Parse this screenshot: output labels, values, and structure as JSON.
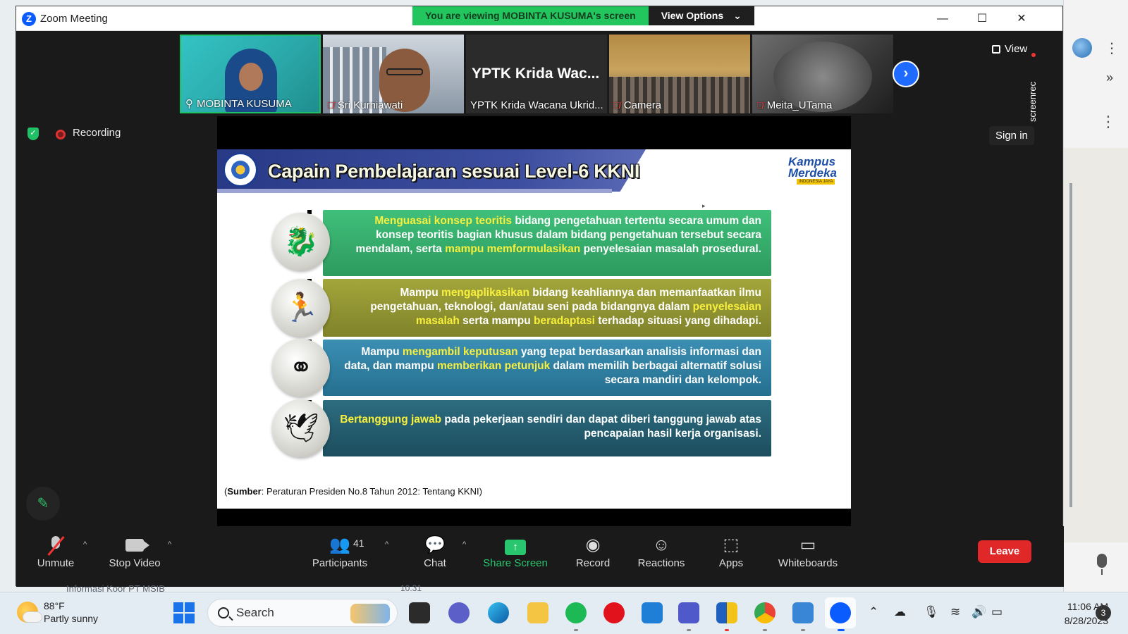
{
  "window": {
    "title": "Zoom Meeting"
  },
  "banner": {
    "viewing_text": "You are viewing MOBINTA KUSUMA's screen",
    "view_options": "View Options"
  },
  "thumbnails": [
    {
      "name": "MOBINTA KUSUMA",
      "muted": false
    },
    {
      "name": "Sri Kurniawati",
      "muted": true
    },
    {
      "name": "YPTK Krida Wacana Ukrid...",
      "display_title": "YPTK Krida Wac...",
      "muted": false
    },
    {
      "name": "Camera",
      "muted": true
    },
    {
      "name": "Meita_UTama",
      "muted": true
    }
  ],
  "meeting": {
    "view_label": "View",
    "screenrec_label": "screenrec",
    "recording_label": "Recording",
    "signin_label": "Sign in"
  },
  "slide": {
    "title": "Capain Pembelajaran sesuai Level-6 KKNI",
    "brand_line1": "Kampus",
    "brand_line2": "Merdeka",
    "brand_sub": "INDONESIA JAYA",
    "rows": [
      {
        "icon": "dragon-icon",
        "parts": [
          {
            "t": "Menguasai konsep teoritis",
            "hl": true
          },
          {
            "t": " bidang pengetahuan tertentu secara umum dan konsep teoritis bagian khusus dalam bidang pengetahuan tersebut secara mendalam, serta ",
            "hl": false
          },
          {
            "t": "mampu memformulasikan",
            "hl": true
          },
          {
            "t": " penyelesaian masalah prosedural.",
            "hl": false
          }
        ]
      },
      {
        "icon": "runner-icon",
        "parts": [
          {
            "t": "Mampu ",
            "hl": false
          },
          {
            "t": "mengaplikasikan",
            "hl": true
          },
          {
            "t": " bidang keahliannya dan memanfaatkan ilmu pengetahuan, teknologi, dan/atau seni pada bidangnya dalam ",
            "hl": false
          },
          {
            "t": "penyelesaian masalah",
            "hl": true
          },
          {
            "t": " serta mampu ",
            "hl": false
          },
          {
            "t": "beradaptasi",
            "hl": true
          },
          {
            "t": " terhadap situasi yang dihadapi.",
            "hl": false
          }
        ]
      },
      {
        "icon": "venn-icon",
        "parts": [
          {
            "t": "Mampu ",
            "hl": false
          },
          {
            "t": "mengambil keputusan",
            "hl": true
          },
          {
            "t": " yang tepat berdasarkan analisis informasi dan data, dan mampu ",
            "hl": false
          },
          {
            "t": "memberikan petunjuk",
            "hl": true
          },
          {
            "t": " dalam memilih berbagai alternatif solusi secara mandiri dan kelompok.",
            "hl": false
          }
        ]
      },
      {
        "icon": "dove-icon",
        "parts": [
          {
            "t": "Bertanggung jawab",
            "hl": true
          },
          {
            "t": " pada pekerjaan sendiri dan dapat diberi tanggung jawab atas pencapaian hasil kerja organisasi.",
            "hl": false
          }
        ]
      }
    ],
    "source_label": "Sumber",
    "source_text": ": Peraturan Presiden No.8 Tahun 2012: Tentang KKNI)"
  },
  "toolbar": {
    "unmute": "Unmute",
    "stop_video": "Stop Video",
    "participants": "Participants",
    "participants_count": "41",
    "chat": "Chat",
    "share_screen": "Share Screen",
    "record": "Record",
    "reactions": "Reactions",
    "apps": "Apps",
    "whiteboards": "Whiteboards",
    "leave": "Leave"
  },
  "background": {
    "behind_text": "Informasi Koor PT MSIB",
    "behind_time": "10.31"
  },
  "taskbar": {
    "temp": "88°F",
    "weather": "Partly sunny",
    "search_placeholder": "Search",
    "time": "11:06 AM",
    "date": "8/28/2023",
    "notifications": "3"
  },
  "colors": {
    "zoom_blue": "#0b5cff",
    "share_green": "#28c76f",
    "leave_red": "#e02828",
    "highlight_yellow": "#f8ef3d"
  }
}
